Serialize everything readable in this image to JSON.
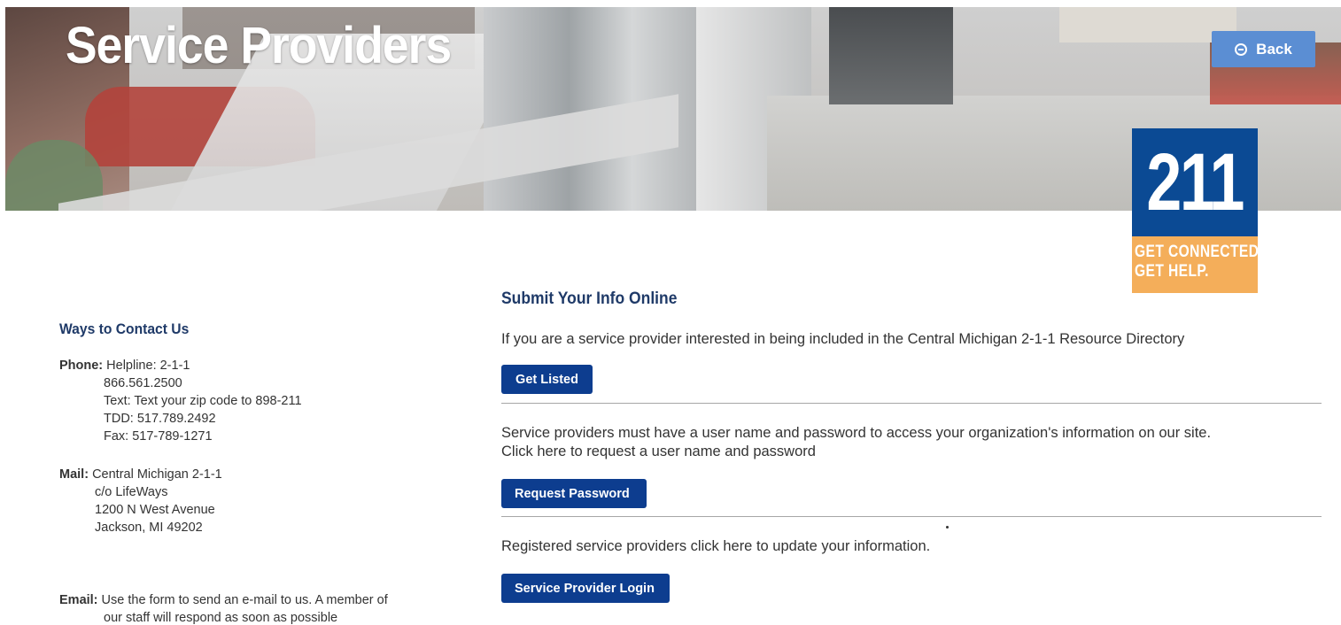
{
  "hero": {
    "title": "Service Providers",
    "back_label": "Back",
    "back_icon": "minus-circle-icon"
  },
  "logo": {
    "number": "211",
    "tagline_1": "GET CONNECTED.",
    "tagline_2": "GET HELP.",
    "colors": {
      "blue": "#0b4a94",
      "orange": "#f4ae5a"
    }
  },
  "contact": {
    "heading": "Ways to Contact Us",
    "phone": {
      "label": "Phone:",
      "lines": [
        "Helpline: 2-1-1",
        "866.561.2500",
        "Text: Text your zip code to 898-211",
        "TDD: 517.789.2492",
        "Fax: 517-789-1271"
      ]
    },
    "mail": {
      "label": "Mail:",
      "lines": [
        "Central Michigan 2-1-1",
        "c/o LifeWays",
        "1200 N West Avenue",
        "Jackson, MI 49202"
      ]
    },
    "email": {
      "label": "Email:",
      "lines": [
        "Use the form to send an e-mail to us. A member of",
        "our staff will respond as soon as possible"
      ]
    }
  },
  "submit": {
    "heading": "Submit Your Info Online",
    "intro": "If you are a service provider interested in being included in the Central Michigan 2-1-1 Resource Directory",
    "get_listed_label": "Get Listed",
    "password_text_1": "Service providers must have a user name and password to access your organization's information on our site.",
    "password_text_2": "Click here to request a user name and password",
    "request_password_label": "Request Password",
    "login_text": "Registered service providers click here to update your information.",
    "login_label": "Service Provider Login",
    "button_color": "#0d3d8f"
  }
}
